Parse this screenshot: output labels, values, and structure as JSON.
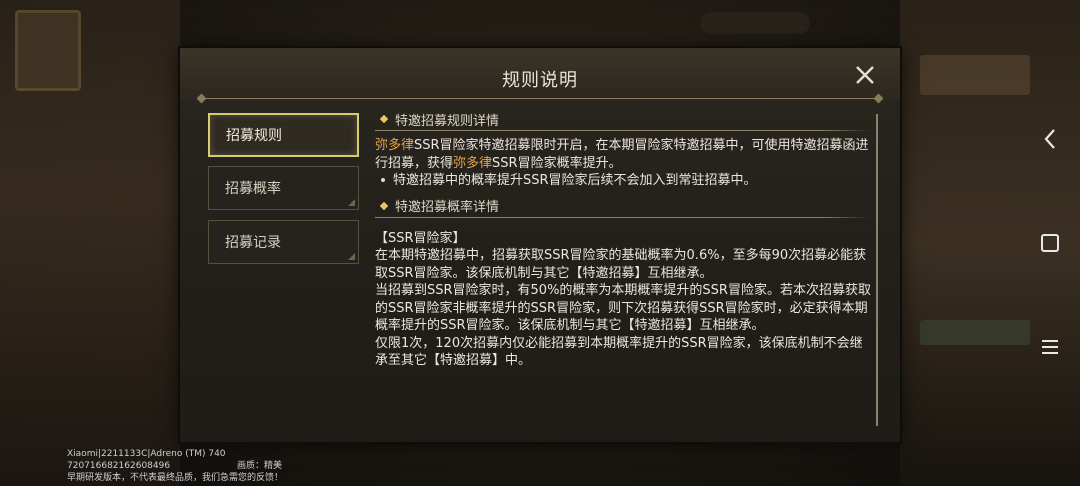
{
  "modal": {
    "title": "规则说明",
    "close_icon": "close-icon"
  },
  "tabs": [
    {
      "label": "招募规则",
      "active": true
    },
    {
      "label": "招募概率",
      "active": false
    },
    {
      "label": "招募记录",
      "active": false
    }
  ],
  "content": {
    "section1_title": "特邀招募规则详情",
    "s1_hl1": "弥多律",
    "s1_t1": "SSR冒险家特邀招募限时开启，在本期冒险家特邀招募中，可使用特邀招募函进行招募，获得",
    "s1_hl2": "弥多律",
    "s1_t2": "SSR冒险家概率提升。",
    "s1_bullet": "特邀招募中的概率提升SSR冒险家后续不会加入到常驻招募中。",
    "section2_title": "特邀招募概率详情",
    "s2_heading": "【SSR冒险家】",
    "s2_p1": "在本期特邀招募中，招募获取SSR冒险家的基础概率为0.6%，至多每90次招募必能获取SSR冒险家。该保底机制与其它【特邀招募】互相继承。",
    "s2_p2": "当招募到SSR冒险家时，有50%的概率为本期概率提升的SSR冒险家。若本次招募获取的SSR冒险家非概率提升的SSR冒险家，则下次招募获得SSR冒险家时，必定获得本期概率提升的SSR冒险家。该保底机制与其它【特邀招募】互相继承。",
    "s2_p3": "仅限1次，120次招募内仅必能招募到本期概率提升的SSR冒险家，该保底机制不会继承至其它【特邀招募】中。"
  },
  "footer": {
    "line1": "Xiaomi|2211133C|Adreno (TM) 740",
    "line2": "720716682162608496",
    "quality": "画质：精美",
    "line3": "早期研发版本，不代表最终品质，我们急需您的反馈！"
  },
  "nav": {
    "back_icon": "chevron-left-icon",
    "home_icon": "square-icon",
    "menu_icon": "menu-icon"
  },
  "colors": {
    "highlight": "#e8a54a",
    "active_tab_border": "#d8cc72",
    "bullet_diamond": "#e7c664"
  }
}
